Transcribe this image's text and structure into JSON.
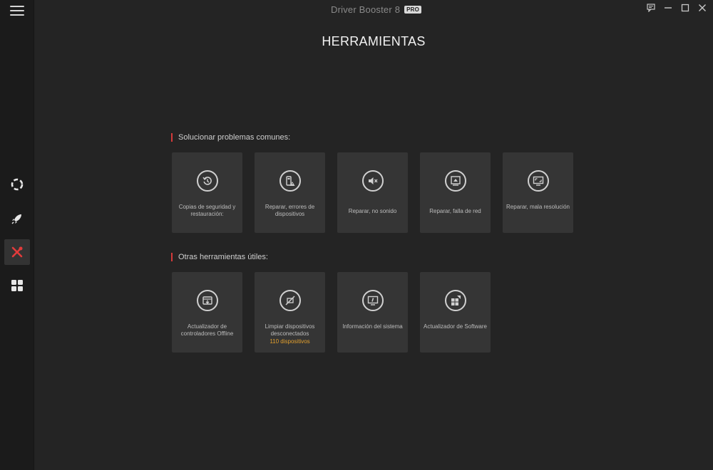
{
  "app": {
    "title": "Driver Booster 8",
    "badge": "PRO"
  },
  "sidebar": {
    "items": [
      {
        "name": "scan",
        "icon": "ring-icon"
      },
      {
        "name": "boost",
        "icon": "rocket-icon"
      },
      {
        "name": "tools",
        "icon": "tools-icon",
        "active": true
      },
      {
        "name": "action-center",
        "icon": "grid-icon"
      }
    ]
  },
  "page": {
    "title": "HERRAMIENTAS"
  },
  "sections": [
    {
      "label": "Solucionar problemas comunes:",
      "cards": [
        {
          "label": "Copias de seguridad y restauración:",
          "icon": "restore-icon"
        },
        {
          "label": "Reparar, errores de dispositivos",
          "icon": "device-error-icon"
        },
        {
          "label": "Reparar, no sonido",
          "icon": "sound-mute-icon"
        },
        {
          "label": "Reparar, falla de red",
          "icon": "network-icon"
        },
        {
          "label": "Reparar, mala resolución",
          "icon": "resolution-icon"
        }
      ]
    },
    {
      "label": "Otras herramientas útiles:",
      "cards": [
        {
          "label": "Actualizador de controladores Offline",
          "icon": "offline-updater-icon"
        },
        {
          "label": "Limpiar dispositivos desconectados",
          "sub": "110 dispositivos",
          "icon": "clean-device-icon"
        },
        {
          "label": "Información del sistema",
          "icon": "system-info-icon"
        },
        {
          "label": "Actualizador de Software",
          "icon": "software-updater-icon"
        }
      ]
    }
  ],
  "colors": {
    "accent": "#d43a3a",
    "highlight": "#e3a02d",
    "card": "#353535",
    "background": "#242424"
  }
}
